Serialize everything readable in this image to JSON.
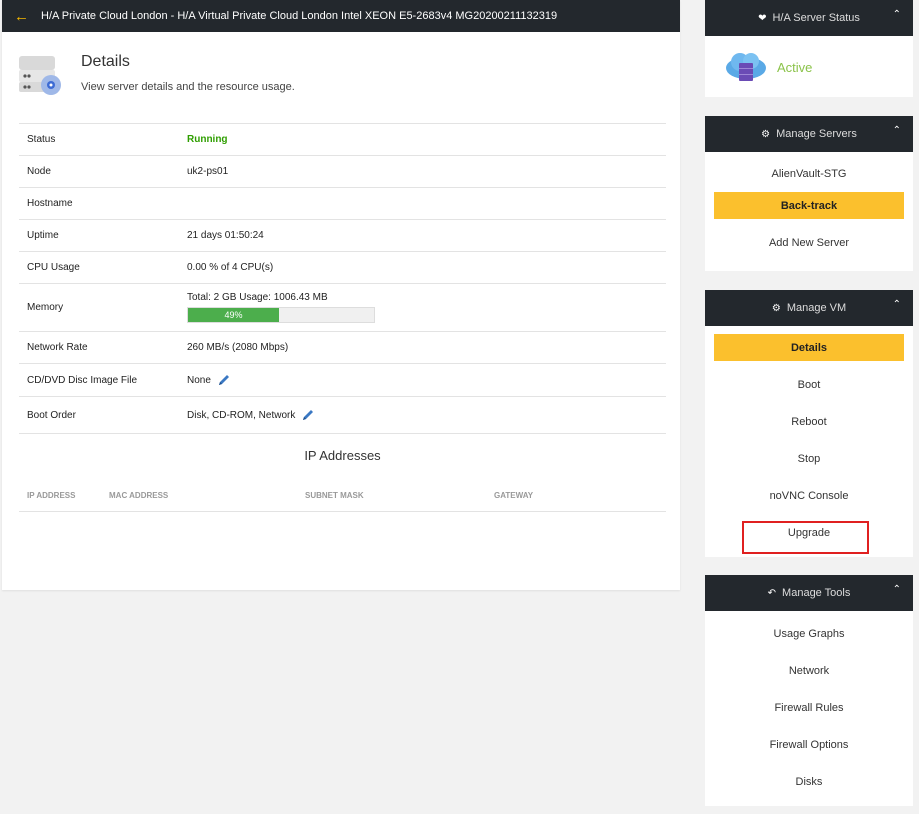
{
  "header": {
    "back_icon": "arrow-left-icon",
    "title": "H/A Private Cloud London - H/A Virtual Private Cloud London Intel XEON E5-2683v4 MG20200211132319"
  },
  "details": {
    "icon": "server-disk-icon",
    "title": "Details",
    "subtitle": "View server details and the resource usage."
  },
  "info": {
    "status": {
      "label": "Status",
      "value": "Running",
      "color": "#2f9e00"
    },
    "node": {
      "label": "Node",
      "value": "uk2-ps01"
    },
    "hostname": {
      "label": "Hostname",
      "value": ""
    },
    "uptime": {
      "label": "Uptime",
      "value": "21 days 01:50:24"
    },
    "cpu": {
      "label": "CPU Usage",
      "value": "0.00 % of 4 CPU(s)"
    },
    "memory": {
      "label": "Memory",
      "value": "Total: 2 GB Usage: 1006.43 MB",
      "progress_label": "49%",
      "progress_percent": 49
    },
    "network": {
      "label": "Network Rate",
      "value": "260 MB/s (2080 Mbps)"
    },
    "cd": {
      "label": "CD/DVD Disc Image File",
      "value": "None",
      "edit_icon": "pencil-icon"
    },
    "boot": {
      "label": "Boot Order",
      "value": "Disk, CD-ROM, Network",
      "edit_icon": "pencil-icon"
    }
  },
  "ip": {
    "title": "IP Addresses",
    "columns": {
      "ip": "IP ADDRESS",
      "mac": "MAC ADDRESS",
      "subnet": "SUBNET MASK",
      "gateway": "GATEWAY"
    }
  },
  "sidebar": {
    "status_panel": {
      "title": "H/A Server Status",
      "icon": "heartbeat-icon",
      "status": "Active",
      "status_color": "#8bc34a"
    },
    "manage_servers": {
      "title": "Manage Servers",
      "items": [
        "AlienVault-STG",
        "Back-track",
        "Add New Server"
      ],
      "active": "Back-track"
    },
    "manage_vm": {
      "title": "Manage VM",
      "items": [
        "Details",
        "Boot",
        "Reboot",
        "Stop",
        "noVNC Console",
        "Upgrade"
      ],
      "active": "Details"
    },
    "manage_tools": {
      "title": "Manage Tools",
      "items": [
        "Usage Graphs",
        "Network",
        "Firewall Rules",
        "Firewall Options",
        "Disks"
      ]
    }
  },
  "colors": {
    "accent": "#fbc02d",
    "header_bg": "#23282d",
    "highlight": "#e02020"
  }
}
